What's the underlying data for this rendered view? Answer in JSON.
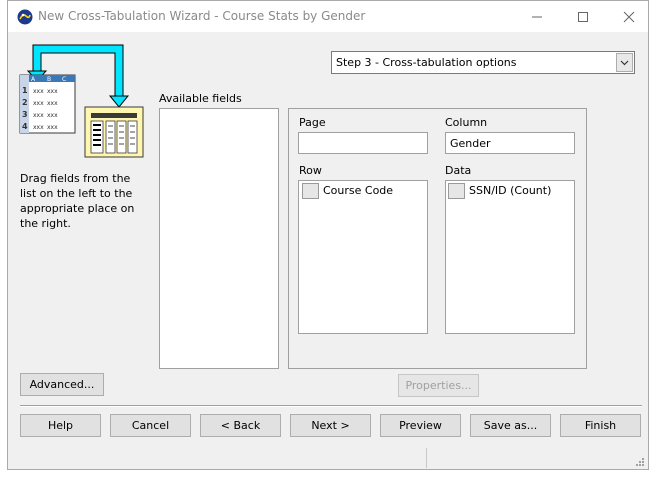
{
  "window": {
    "title": "New Cross-Tabulation Wizard - Course Stats by Gender",
    "controls": {
      "minimize": "minimize-icon",
      "maximize": "maximize-icon",
      "close": "close-icon"
    }
  },
  "illustration": {
    "columns": [
      "A",
      "B",
      "C"
    ],
    "rows": [
      "1",
      "2",
      "3",
      "4"
    ],
    "cell_text": "xxx"
  },
  "step_selector": {
    "value": "Step 3 - Cross-tabulation options"
  },
  "instructions": "Drag fields from the list on the left to the appropriate place on the right.",
  "available_fields": {
    "label": "Available fields",
    "items": []
  },
  "zones": {
    "page": {
      "label": "Page",
      "value": ""
    },
    "column": {
      "label": "Column",
      "value": "Gender"
    },
    "row": {
      "label": "Row",
      "items": [
        "Course Code"
      ]
    },
    "data": {
      "label": "Data",
      "items": [
        "SSN/ID (Count)"
      ]
    }
  },
  "buttons": {
    "advanced": "Advanced...",
    "properties": "Properties...",
    "help": "Help",
    "cancel": "Cancel",
    "back": "< Back",
    "next": "Next >",
    "preview": "Preview",
    "save_as": "Save as...",
    "finish": "Finish"
  },
  "colors": {
    "accent_cyan": "#00e5ff",
    "sheet_blue": "#3a78b8",
    "sheet_yellow": "#fff6b0"
  }
}
